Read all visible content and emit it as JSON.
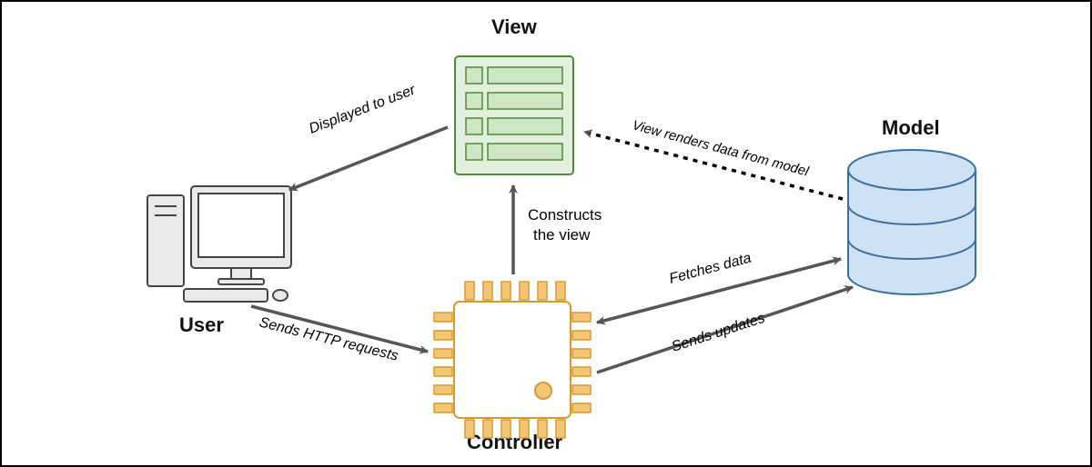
{
  "nodes": {
    "view": {
      "label": "View"
    },
    "model": {
      "label": "Model"
    },
    "user": {
      "label": "User"
    },
    "controller": {
      "label": "Controller"
    }
  },
  "edges": {
    "displayed": "Displayed to user",
    "renders": "View renders data from model",
    "constructs_line1": "Constructs",
    "constructs_line2": "the view",
    "sends_http": "Sends HTTP requests",
    "fetches": "Fetches data",
    "updates": "Sends updates"
  }
}
